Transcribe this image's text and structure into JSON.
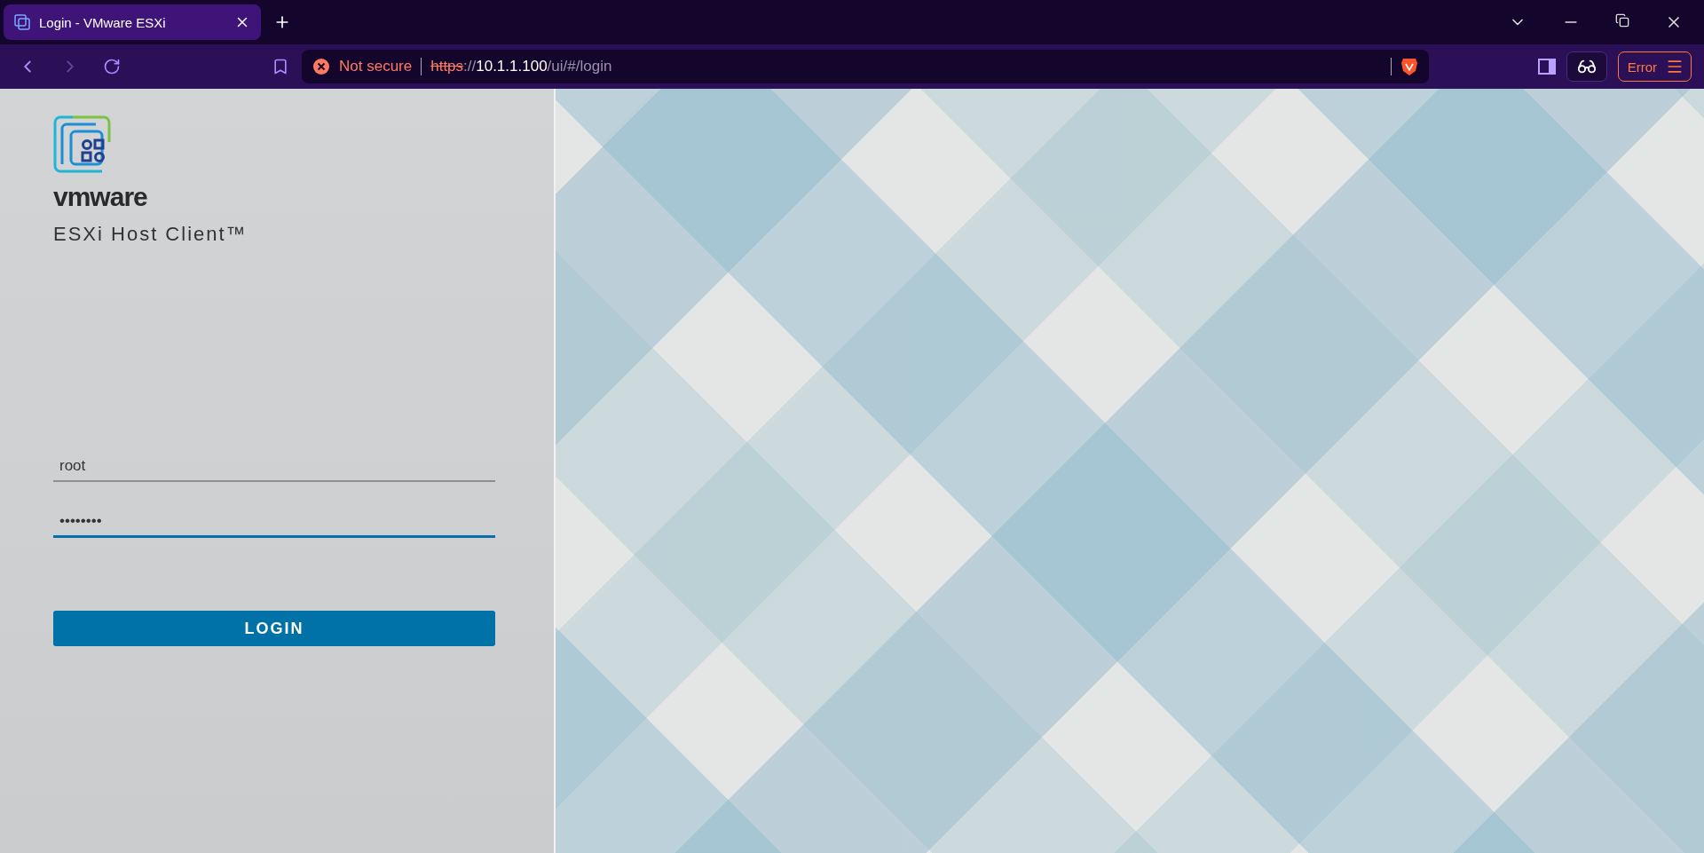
{
  "browser": {
    "tabs": [
      {
        "title": "Login - VMware ESXi",
        "selected": true
      }
    ],
    "address": {
      "security": "Not secure",
      "scheme": "https",
      "separator": "://",
      "host": "10.1.1.100",
      "path": "/ui/#/login"
    },
    "shields_status": "Error"
  },
  "login": {
    "brand": "vmware",
    "product": "ESXi Host Client™",
    "username": "root",
    "password": "••••••••",
    "button": "LOGIN"
  }
}
